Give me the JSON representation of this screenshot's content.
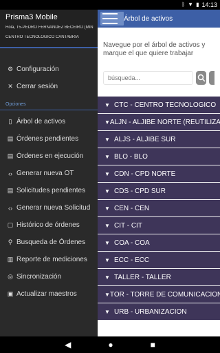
{
  "status": {
    "time": "14:13"
  },
  "main": {
    "title": "Árbol de activos",
    "helptext": "Navegue por el árbol de activos y marque el que quiere trabajar",
    "search_placeholder": "búsqueda...",
    "assets": [
      "CTC - CENTRO TECNOLOGICO",
      "ALJN - ALJIBE NORTE (REUTILIZADA)",
      "ALJS - ALJIBE SUR",
      "BLO - BLO",
      "CDN - CPD NORTE",
      "CDS - CPD SUR",
      "CEN - CEN",
      "CIT - CIT",
      "COA - COA",
      "ECC - ECC",
      "TALLER - TALLER",
      "TOR - TORRE DE COMUNICACIONES",
      "URB - URBANIZACION"
    ]
  },
  "drawer": {
    "app_name": "Prisma3 Mobile",
    "user": "Hola, T5-PEDRO FERNANDEZ BECEIRO (MINSAIT)",
    "center": "CENTRO TECNOLOGICO CANTABRIA",
    "top_items": [
      {
        "label": "Configuración",
        "icon": "gear-icon",
        "glyph": "⚙"
      },
      {
        "label": "Cerrar sesión",
        "icon": "close-icon",
        "glyph": "✕"
      }
    ],
    "section": "Opciones",
    "items": [
      {
        "label": "Árbol de activos",
        "icon": "tree-icon",
        "glyph": "▯"
      },
      {
        "label": "Órdenes pendientes",
        "icon": "list-icon",
        "glyph": "▤"
      },
      {
        "label": "Órdenes en ejecución",
        "icon": "list-icon",
        "glyph": "▤"
      },
      {
        "label": "Generar nueva OT",
        "icon": "code-icon",
        "glyph": "‹›"
      },
      {
        "label": "Solicitudes pendientes",
        "icon": "list-icon",
        "glyph": "▤"
      },
      {
        "label": "Generar nueva Solicitud",
        "icon": "code-icon",
        "glyph": "‹›"
      },
      {
        "label": "Histórico de órdenes",
        "icon": "history-icon",
        "glyph": "▢"
      },
      {
        "label": "Busqueda de Órdenes",
        "icon": "search-icon",
        "glyph": "⚲"
      },
      {
        "label": "Reporte de mediciones",
        "icon": "report-icon",
        "glyph": "▥"
      },
      {
        "label": "Sincronización",
        "icon": "sync-icon",
        "glyph": "◎"
      },
      {
        "label": "Actualizar maestros",
        "icon": "update-icon",
        "glyph": "▣"
      }
    ]
  },
  "nav": {
    "back": "◀",
    "home": "●",
    "recents": "■"
  }
}
